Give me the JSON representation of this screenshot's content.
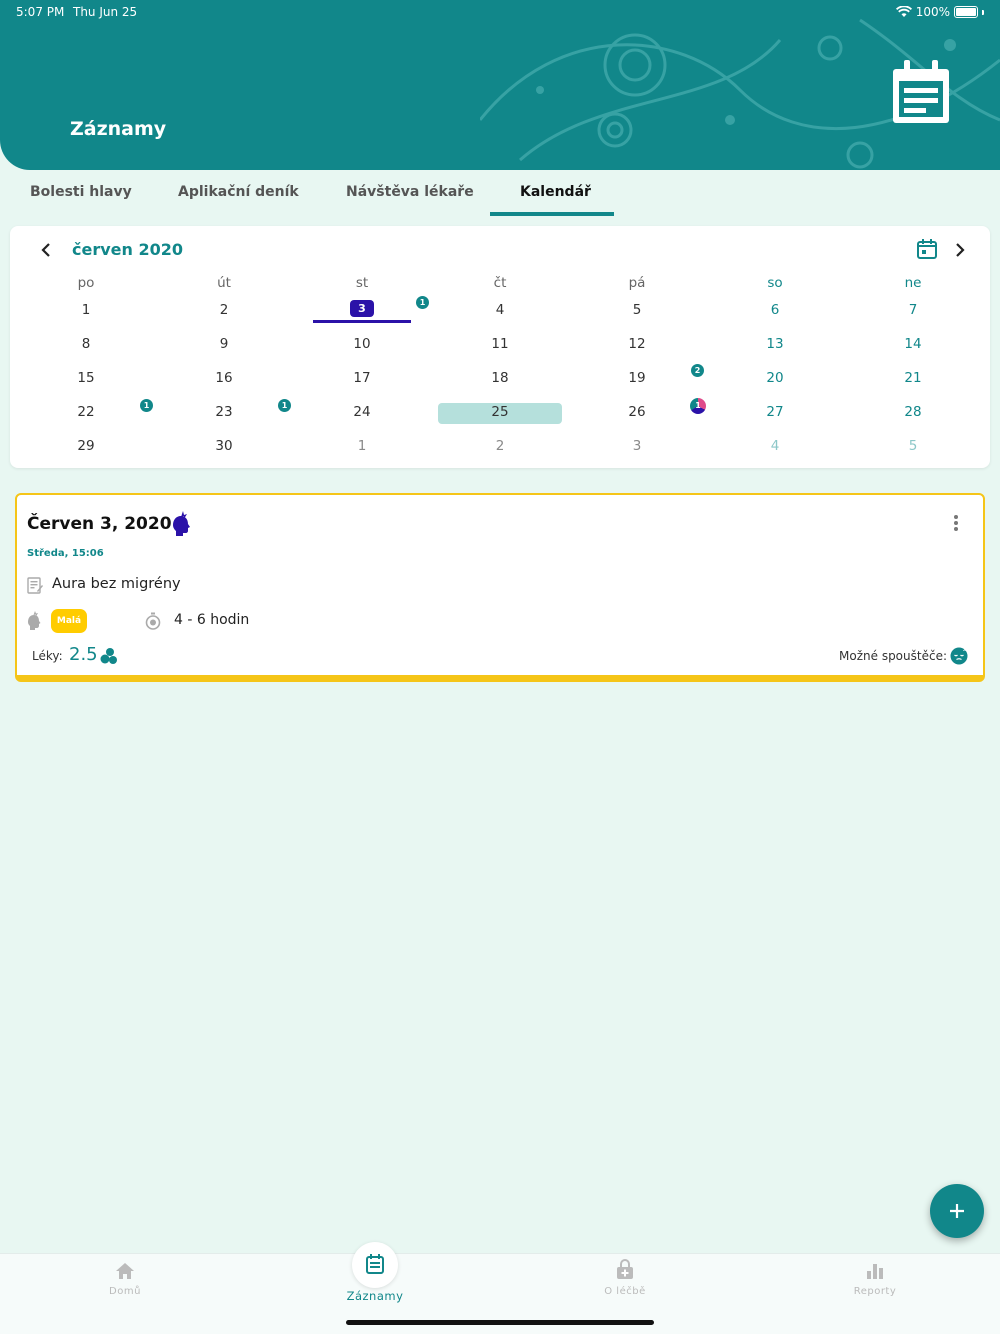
{
  "status_bar": {
    "time": "5:07 PM",
    "date": "Thu Jun 25",
    "battery": "100%"
  },
  "header": {
    "title": "Záznamy"
  },
  "tabs": [
    {
      "label": "Bolesti hlavy"
    },
    {
      "label": "Aplikační deník"
    },
    {
      "label": "Návštěva lékaře"
    },
    {
      "label": "Kalendář",
      "active": true
    }
  ],
  "calendar": {
    "month_label": "červen 2020",
    "weekdays": [
      "po",
      "út",
      "st",
      "čt",
      "pá",
      "so",
      "ne"
    ],
    "weeks": [
      [
        "1",
        "2",
        "3",
        "4",
        "5",
        "6",
        "7"
      ],
      [
        "8",
        "9",
        "10",
        "11",
        "12",
        "13",
        "14"
      ],
      [
        "15",
        "16",
        "17",
        "18",
        "19",
        "20",
        "21"
      ],
      [
        "22",
        "23",
        "24",
        "25",
        "26",
        "27",
        "28"
      ],
      [
        "29",
        "30",
        "1",
        "2",
        "3",
        "4",
        "5"
      ]
    ],
    "selected_day": "3",
    "today": "25",
    "markers": [
      "1",
      "2",
      "1",
      "1",
      "1"
    ]
  },
  "record": {
    "title": "Červen 3, 2020",
    "subtitle": "Středa, 15:06",
    "note": "Aura bez migrény",
    "intensity": "Malá",
    "duration": "4 - 6 hodin",
    "meds_label": "Léky:",
    "meds_value": "2.5",
    "triggers_label": "Možné spouštěče:"
  },
  "bottom_nav": [
    {
      "label": "Domů"
    },
    {
      "label": "Záznamy",
      "active": true
    },
    {
      "label": "O léčbě"
    },
    {
      "label": "Reporty"
    }
  ],
  "colors": {
    "primary": "#11878a",
    "accent": "#f5c518",
    "selected": "#2b12a8",
    "background": "#e8f7f2"
  }
}
